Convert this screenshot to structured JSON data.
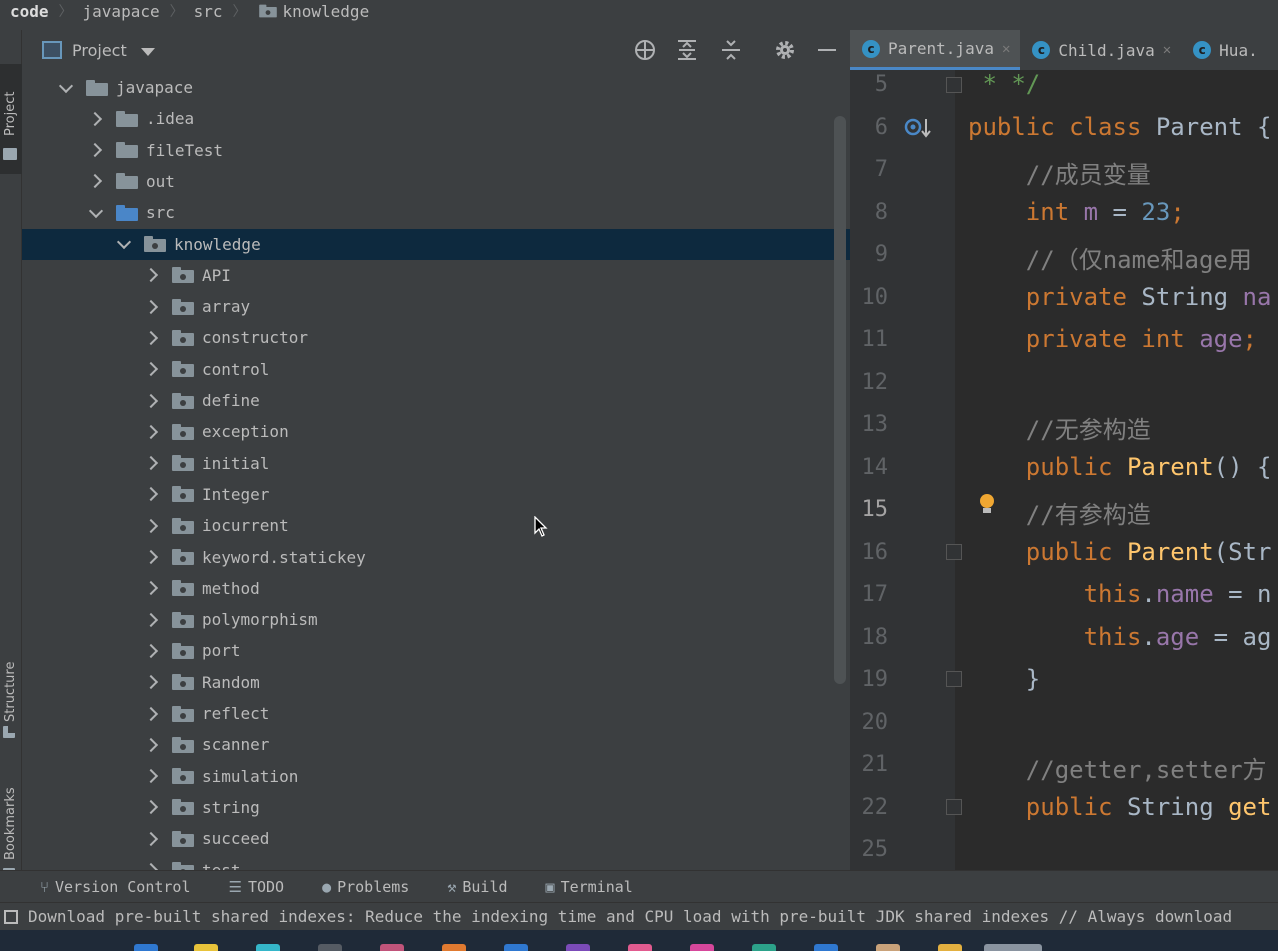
{
  "breadcrumb": {
    "items": [
      "code",
      "javapace",
      "src",
      "knowledge"
    ]
  },
  "left_stripe": {
    "project": "Project",
    "structure": "Structure",
    "bookmarks": "Bookmarks"
  },
  "project_panel": {
    "title": "Project",
    "tree": [
      {
        "label": "javapace",
        "level": 1,
        "expanded": true,
        "folder": "plain"
      },
      {
        "label": ".idea",
        "level": 2,
        "expanded": false,
        "folder": "plain"
      },
      {
        "label": "fileTest",
        "level": 2,
        "expanded": false,
        "folder": "plain"
      },
      {
        "label": "out",
        "level": 2,
        "expanded": false,
        "folder": "plain"
      },
      {
        "label": "src",
        "level": 2,
        "expanded": true,
        "folder": "source"
      },
      {
        "label": "knowledge",
        "level": 3,
        "expanded": true,
        "folder": "package",
        "selected": true
      },
      {
        "label": "API",
        "level": 4,
        "expanded": false,
        "folder": "package"
      },
      {
        "label": "array",
        "level": 4,
        "expanded": false,
        "folder": "package"
      },
      {
        "label": "constructor",
        "level": 4,
        "expanded": false,
        "folder": "package"
      },
      {
        "label": "control",
        "level": 4,
        "expanded": false,
        "folder": "package"
      },
      {
        "label": "define",
        "level": 4,
        "expanded": false,
        "folder": "package"
      },
      {
        "label": "exception",
        "level": 4,
        "expanded": false,
        "folder": "package"
      },
      {
        "label": "initial",
        "level": 4,
        "expanded": false,
        "folder": "package"
      },
      {
        "label": "Integer",
        "level": 4,
        "expanded": false,
        "folder": "package"
      },
      {
        "label": "iocurrent",
        "level": 4,
        "expanded": false,
        "folder": "package"
      },
      {
        "label": "keyword.statickey",
        "level": 4,
        "expanded": false,
        "folder": "package"
      },
      {
        "label": "method",
        "level": 4,
        "expanded": false,
        "folder": "package"
      },
      {
        "label": "polymorphism",
        "level": 4,
        "expanded": false,
        "folder": "package"
      },
      {
        "label": "port",
        "level": 4,
        "expanded": false,
        "folder": "package"
      },
      {
        "label": "Random",
        "level": 4,
        "expanded": false,
        "folder": "package"
      },
      {
        "label": "reflect",
        "level": 4,
        "expanded": false,
        "folder": "package"
      },
      {
        "label": "scanner",
        "level": 4,
        "expanded": false,
        "folder": "package"
      },
      {
        "label": "simulation",
        "level": 4,
        "expanded": false,
        "folder": "package"
      },
      {
        "label": "string",
        "level": 4,
        "expanded": false,
        "folder": "package"
      },
      {
        "label": "succeed",
        "level": 4,
        "expanded": false,
        "folder": "package"
      },
      {
        "label": "test",
        "level": 4,
        "expanded": false,
        "folder": "package"
      }
    ]
  },
  "editor": {
    "tabs": [
      {
        "name": "Parent.java",
        "active": true,
        "closable": true
      },
      {
        "name": "Child.java",
        "active": false,
        "closable": true
      },
      {
        "name": "Hua.",
        "active": false,
        "closable": false
      }
    ],
    "current_line": "15",
    "lines": [
      {
        "n": "5",
        "tokens": [
          [
            "doc",
            " * */"
          ]
        ]
      },
      {
        "n": "6",
        "tokens": [
          [
            "kw",
            "public class "
          ],
          [
            "plain",
            "Parent {"
          ]
        ]
      },
      {
        "n": "7",
        "tokens": [
          [
            "plain",
            "    "
          ],
          [
            "cm",
            "//成员变量"
          ]
        ]
      },
      {
        "n": "8",
        "tokens": [
          [
            "plain",
            "    "
          ],
          [
            "kw",
            "int "
          ],
          [
            "fld",
            "m"
          ],
          [
            "plain",
            " = "
          ],
          [
            "num",
            "23"
          ],
          [
            "kw",
            ";"
          ]
        ]
      },
      {
        "n": "9",
        "tokens": [
          [
            "plain",
            "    "
          ],
          [
            "cm",
            "//（仅name和age用"
          ]
        ]
      },
      {
        "n": "10",
        "tokens": [
          [
            "plain",
            "    "
          ],
          [
            "kw",
            "private "
          ],
          [
            "plain",
            "String "
          ],
          [
            "fld",
            "na"
          ]
        ]
      },
      {
        "n": "11",
        "tokens": [
          [
            "plain",
            "    "
          ],
          [
            "kw",
            "private int "
          ],
          [
            "fld",
            "age"
          ],
          [
            "kw",
            ";"
          ]
        ]
      },
      {
        "n": "12",
        "tokens": [
          [
            "plain",
            ""
          ]
        ]
      },
      {
        "n": "13",
        "tokens": [
          [
            "plain",
            "    "
          ],
          [
            "cm",
            "//无参构造"
          ]
        ]
      },
      {
        "n": "14",
        "tokens": [
          [
            "plain",
            "    "
          ],
          [
            "kw",
            "public "
          ],
          [
            "fn",
            "Parent"
          ],
          [
            "plain",
            "() {"
          ]
        ]
      },
      {
        "n": "15",
        "tokens": [
          [
            "plain",
            "    "
          ],
          [
            "cm",
            "//有参构造"
          ]
        ]
      },
      {
        "n": "16",
        "tokens": [
          [
            "plain",
            "    "
          ],
          [
            "kw",
            "public "
          ],
          [
            "fn",
            "Parent"
          ],
          [
            "plain",
            "(Str"
          ]
        ]
      },
      {
        "n": "17",
        "tokens": [
          [
            "plain",
            "        "
          ],
          [
            "kw",
            "this"
          ],
          [
            "plain",
            "."
          ],
          [
            "fld",
            "name"
          ],
          [
            "plain",
            " = n"
          ]
        ]
      },
      {
        "n": "18",
        "tokens": [
          [
            "plain",
            "        "
          ],
          [
            "kw",
            "this"
          ],
          [
            "plain",
            "."
          ],
          [
            "fld",
            "age"
          ],
          [
            "plain",
            " = ag"
          ]
        ]
      },
      {
        "n": "19",
        "tokens": [
          [
            "plain",
            "    }"
          ]
        ]
      },
      {
        "n": "20",
        "tokens": [
          [
            "plain",
            ""
          ]
        ]
      },
      {
        "n": "21",
        "tokens": [
          [
            "plain",
            "    "
          ],
          [
            "cm",
            "//getter,setter方"
          ]
        ]
      },
      {
        "n": "22",
        "tokens": [
          [
            "plain",
            "    "
          ],
          [
            "kw",
            "public "
          ],
          [
            "plain",
            "String "
          ],
          [
            "fn",
            "get"
          ]
        ]
      },
      {
        "n": "25",
        "tokens": [
          [
            "plain",
            ""
          ]
        ]
      }
    ]
  },
  "bottom_toolbar": {
    "items": [
      {
        "label": "Version Control",
        "icon": "vcs-branch-icon"
      },
      {
        "label": "TODO",
        "icon": "list-icon"
      },
      {
        "label": "Problems",
        "icon": "info-icon"
      },
      {
        "label": "Build",
        "icon": "hammer-icon"
      },
      {
        "label": "Terminal",
        "icon": "terminal-icon"
      }
    ]
  },
  "status_bar": {
    "message": "Download pre-built shared indexes: Reduce the indexing time and CPU load with pre-built JDK shared indexes // Always download"
  },
  "colors": {
    "selection": "#0d293e",
    "keyword": "#cc7832",
    "comment": "#808080",
    "function": "#ffc66d",
    "field": "#9876aa",
    "number": "#6897bb",
    "doc_comment": "#629755"
  }
}
